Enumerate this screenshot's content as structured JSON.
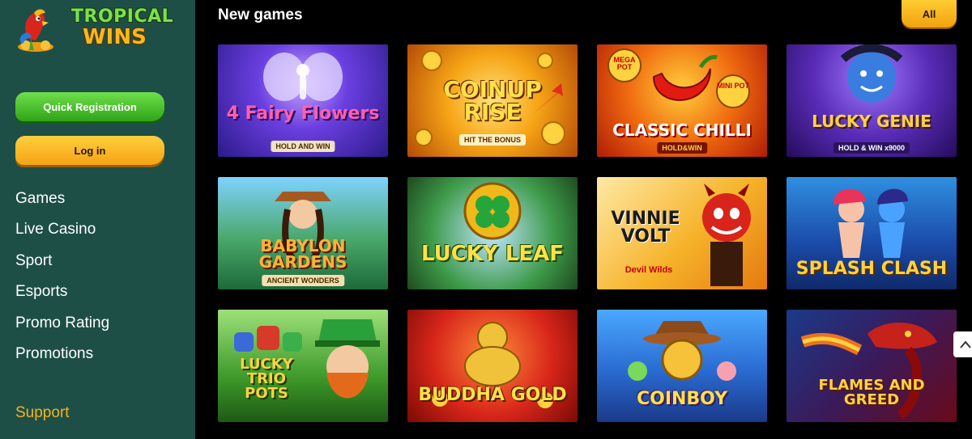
{
  "brand": {
    "line1": "TROPICAL",
    "line2": "WINS"
  },
  "sidebar": {
    "register_label": "Quick Registration",
    "login_label": "Log in",
    "nav": [
      "Games",
      "Live Casino",
      "Sport",
      "Esports",
      "Promo Rating",
      "Promotions"
    ],
    "support_label": "Support"
  },
  "main": {
    "section_title": "New games",
    "all_label": "All",
    "games": [
      {
        "title": "4 Fairy Flowers",
        "subtitle": "HOLD AND WIN"
      },
      {
        "title": "COINUP RISE",
        "subtitle": "HIT THE BONUS"
      },
      {
        "title": "CLASSIC CHILLI",
        "subtitle": "HOLD&WIN",
        "badges": [
          "MEGA POT",
          "MINI POT"
        ]
      },
      {
        "title": "LUCKY GENIE",
        "subtitle": "HOLD & WIN x9000"
      },
      {
        "title": "BABYLON GARDENS",
        "subtitle": "ANCIENT WONDERS"
      },
      {
        "title": "LUCKY LEAF",
        "subtitle": ""
      },
      {
        "title": "VINNIE VOLT",
        "subtitle": "Devil Wilds"
      },
      {
        "title": "SPLASH CLASH",
        "subtitle": ""
      },
      {
        "title": "LUCKY TRIO POTS",
        "subtitle": ""
      },
      {
        "title": "BUDDHA GOLD",
        "subtitle": ""
      },
      {
        "title": "COINBOY",
        "subtitle": ""
      },
      {
        "title": "FLAMES AND GREED",
        "subtitle": ""
      }
    ]
  },
  "colors": {
    "sidebar_bg": "#1d4f47",
    "page_bg": "#000000",
    "accent_yellow": "#f5a314",
    "accent_green": "#2fa418"
  }
}
